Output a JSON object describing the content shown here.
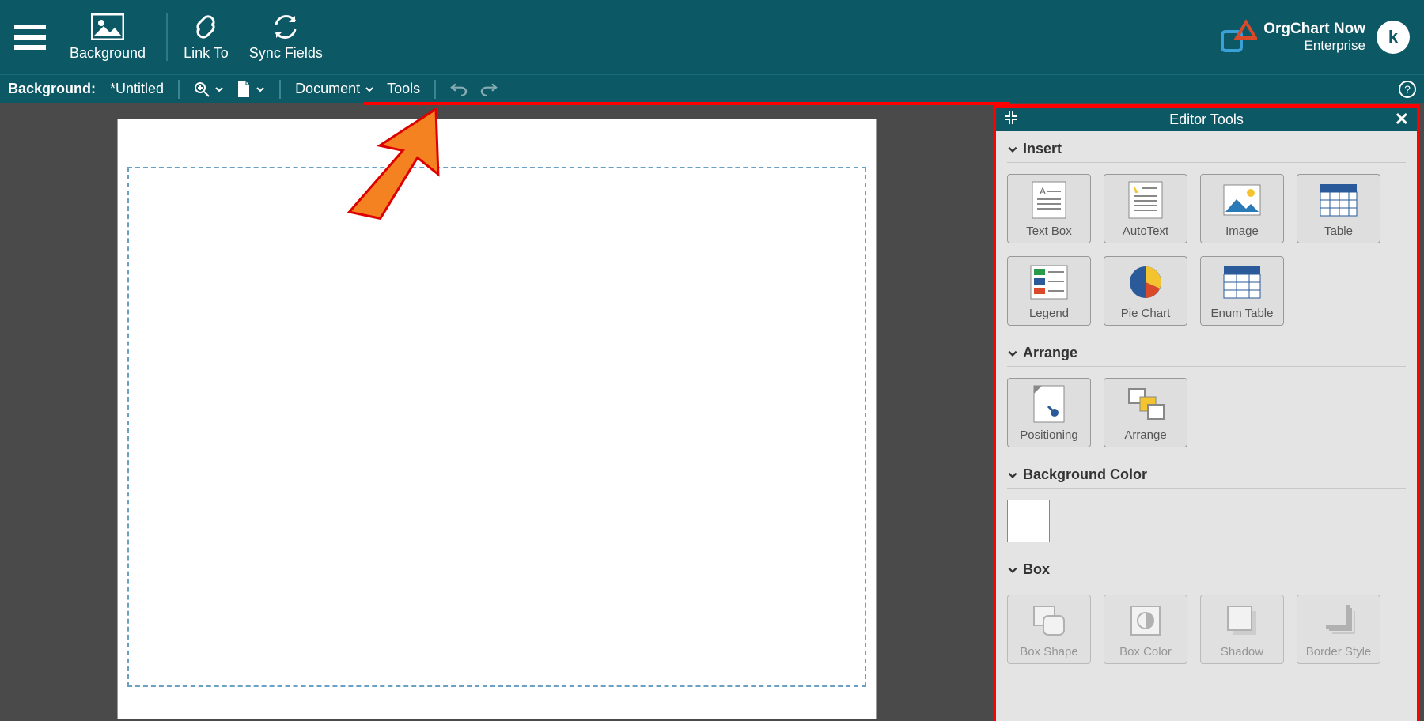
{
  "topbar": {
    "background_label": "Background",
    "linkto_label": "Link To",
    "sync_label": "Sync Fields"
  },
  "brand": {
    "name": "OrgChart Now",
    "tier": "Enterprise",
    "avatar_letter": "k"
  },
  "secbar": {
    "prefix": "Background:",
    "title": "*Untitled",
    "document": "Document",
    "tools": "Tools"
  },
  "panel": {
    "title": "Editor Tools",
    "sections": {
      "insert": {
        "title": "Insert",
        "tiles": {
          "textbox": "Text Box",
          "autotext": "AutoText",
          "image": "Image",
          "table": "Table",
          "legend": "Legend",
          "piechart": "Pie Chart",
          "enumtable": "Enum Table"
        }
      },
      "arrange": {
        "title": "Arrange",
        "tiles": {
          "positioning": "Positioning",
          "arrange": "Arrange"
        }
      },
      "bgcolor": {
        "title": "Background Color"
      },
      "box": {
        "title": "Box",
        "tiles": {
          "boxshape": "Box Shape",
          "boxcolor": "Box Color",
          "shadow": "Shadow",
          "borderstyle": "Border Style"
        }
      }
    }
  }
}
